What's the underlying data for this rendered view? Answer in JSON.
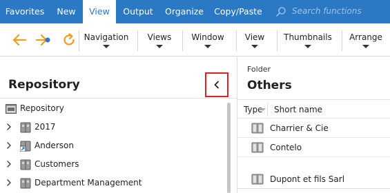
{
  "menubar": {
    "tabs": [
      "Favorites",
      "New",
      "View",
      "Output",
      "Organize",
      "Copy/Paste"
    ],
    "active_tab": "View",
    "search_placeholder": "Search functions"
  },
  "toolbar": {
    "back_icon": "arrow-left-icon",
    "forward_icon": "arrow-right-dot-icon",
    "refresh_icon": "refresh-icon",
    "buttons": [
      "Navigation",
      "Views",
      "Window",
      "View",
      "Thumbnails",
      "Arrange"
    ]
  },
  "repository": {
    "title": "Repository",
    "collapse_icon": "chevron-left-icon",
    "tree": [
      {
        "label": "Repository",
        "icon": "repository-icon",
        "expandable": false
      },
      {
        "label": "2017",
        "icon": "cabinet-icon",
        "expandable": true
      },
      {
        "label": "Anderson",
        "icon": "cabinet-link-icon",
        "expandable": true
      },
      {
        "label": "Customers",
        "icon": "cabinet-icon",
        "expandable": true
      },
      {
        "label": "Department Management",
        "icon": "cabinet-icon",
        "expandable": true
      }
    ]
  },
  "folder": {
    "label": "Folder",
    "title": "Others",
    "columns": [
      "Type",
      "Short name"
    ],
    "rows": [
      "Charrier & Cie",
      "Contelo",
      "Dupont et fils Sarl"
    ]
  },
  "colors": {
    "menubar_bg": "#2b78c4",
    "accent_orange": "#f09a22",
    "highlight_red": "#e02020"
  }
}
